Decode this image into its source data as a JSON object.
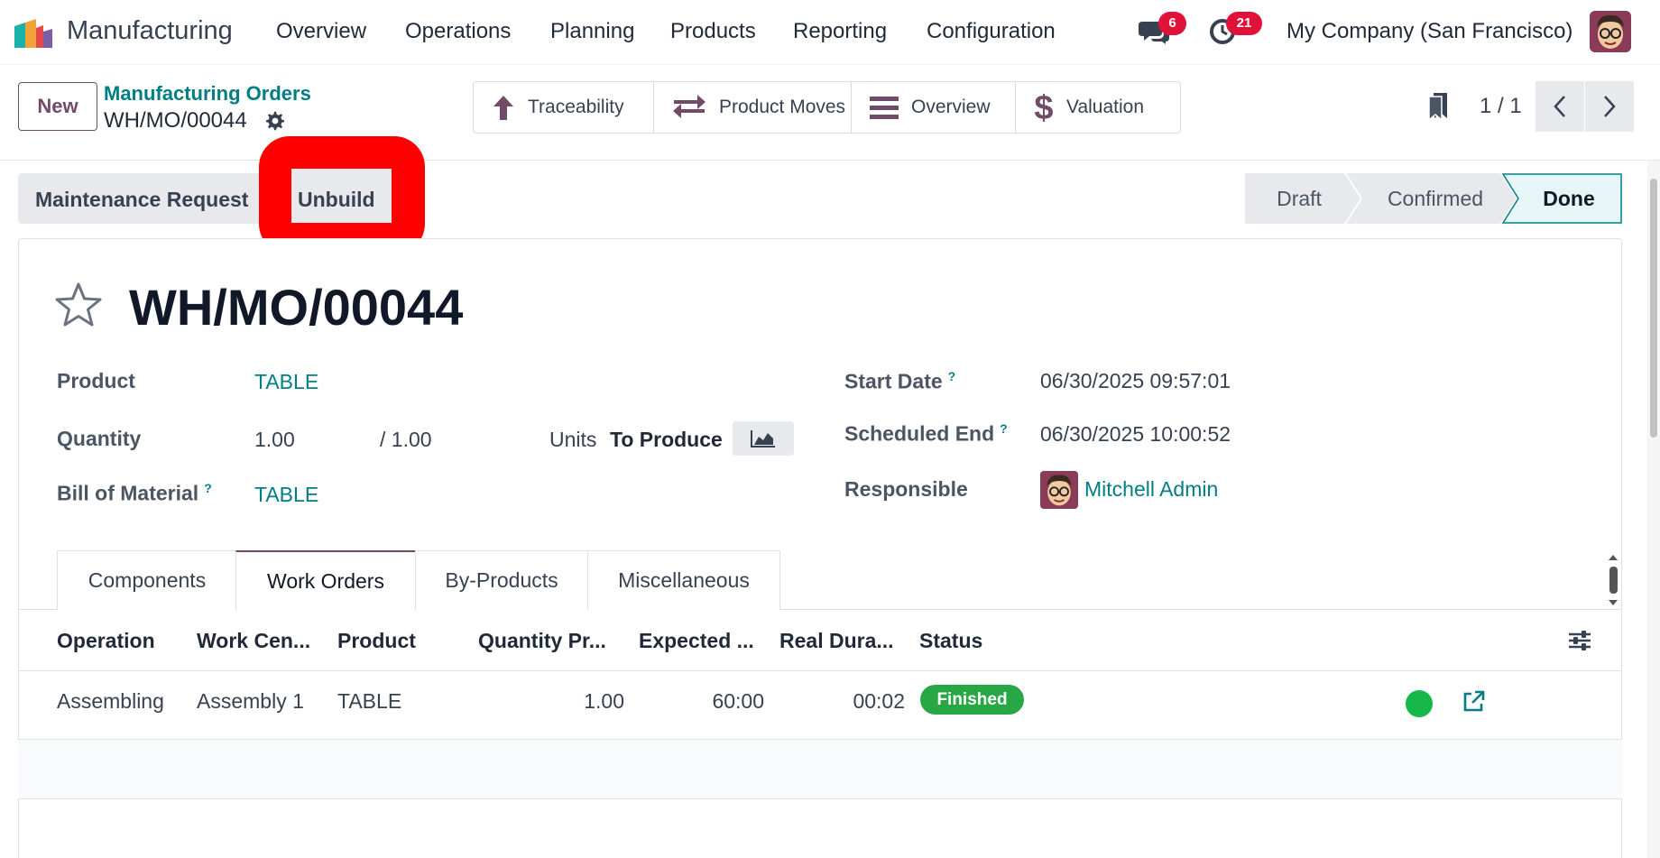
{
  "navbar": {
    "app_name": "Manufacturing",
    "menus": [
      "Overview",
      "Operations",
      "Planning",
      "Products",
      "Reporting",
      "Configuration"
    ],
    "messages_count": "6",
    "activities_count": "21",
    "company": "My Company (San Francisco)"
  },
  "control_panel": {
    "new_label": "New",
    "breadcrumb_parent": "Manufacturing Orders",
    "breadcrumb_current": "WH/MO/00044",
    "smart_buttons": [
      "Traceability",
      "Product Moves",
      "Overview",
      "Valuation"
    ],
    "pager": "1 / 1"
  },
  "actions": {
    "maintenance_request": "Maintenance Request",
    "unbuild": "Unbuild"
  },
  "statusbar": {
    "stages": [
      "Draft",
      "Confirmed",
      "Done"
    ],
    "current": "Done"
  },
  "form": {
    "title": "WH/MO/00044",
    "product_label": "Product",
    "product": "TABLE",
    "quantity_label": "Quantity",
    "quantity": "1.00",
    "quantity_total": "/ 1.00",
    "units_label": "Units",
    "to_produce_label": "To Produce",
    "bom_label": "Bill of Material",
    "bom": "TABLE",
    "start_date_label": "Start Date",
    "start_date": "06/30/2025 09:57:01",
    "scheduled_end_label": "Scheduled End",
    "scheduled_end": "06/30/2025 10:00:52",
    "responsible_label": "Responsible",
    "responsible": "Mitchell Admin",
    "help_mark": "?"
  },
  "tabs": {
    "items": [
      "Components",
      "Work Orders",
      "By-Products",
      "Miscellaneous"
    ],
    "active": "Work Orders"
  },
  "work_orders": {
    "headers": [
      "Operation",
      "Work Cen...",
      "Product",
      "Quantity Pr...",
      "Expected ...",
      "Real Dura...",
      "Status"
    ],
    "rows": [
      {
        "operation": "Assembling",
        "work_center": "Assembly 1",
        "product": "TABLE",
        "quantity": "1.00",
        "expected": "60:00",
        "real_duration": "00:02",
        "status": "Finished"
      }
    ]
  },
  "colors": {
    "brand": "#714b67",
    "link": "#017e84",
    "badge": "#e0123a",
    "finished": "#28a745",
    "highlight": "#ff0000"
  }
}
